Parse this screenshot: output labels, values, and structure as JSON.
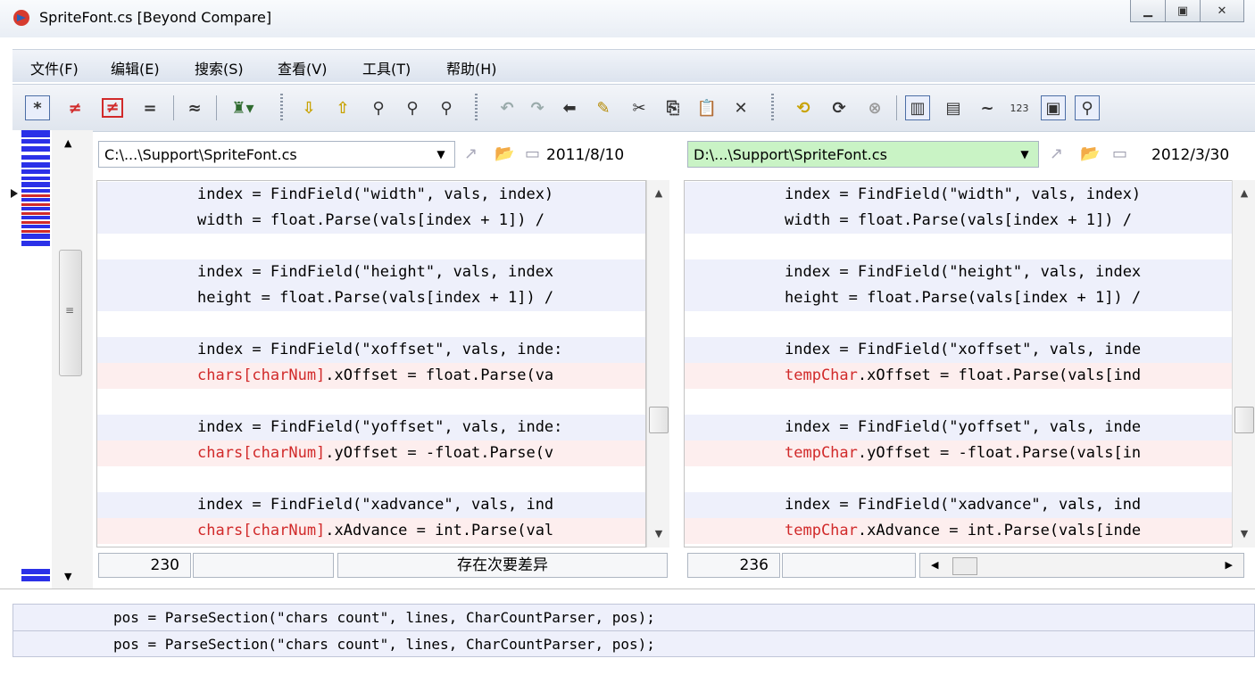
{
  "window": {
    "title": "SpriteFont.cs  [Beyond Compare]"
  },
  "menu": [
    "文件(F)",
    "编辑(E)",
    "搜索(S)",
    "查看(V)",
    "工具(T)",
    "帮助(H)"
  ],
  "colors": {
    "diff_text": "#d12a2a",
    "changed_line_bg": "#fdeeee",
    "line_bg": "#eef0fb",
    "right_path_bg": "#c9f3c5"
  },
  "left": {
    "path": "C:\\...\\Support\\SpriteFont.cs",
    "date": "2011/8/10",
    "line_number": "230",
    "status": "存在次要差异",
    "lines": [
      {
        "text": "index = FindField(\"width\", vals, index)",
        "kind": "blue"
      },
      {
        "text": "width = float.Parse(vals[index + 1]) /",
        "kind": "blue"
      },
      {
        "text": "",
        "kind": "blank"
      },
      {
        "text": "index = FindField(\"height\", vals, index",
        "kind": "blue"
      },
      {
        "text": "height = float.Parse(vals[index + 1]) /",
        "kind": "blue"
      },
      {
        "text": "",
        "kind": "blank"
      },
      {
        "text": "index = FindField(\"xoffset\", vals, inde:",
        "kind": "blue"
      },
      {
        "diff": "chars[charNum]",
        "rest": ".xOffset = float.Parse(va",
        "kind": "pink"
      },
      {
        "text": "",
        "kind": "blank"
      },
      {
        "text": "index = FindField(\"yoffset\", vals, inde:",
        "kind": "blue"
      },
      {
        "diff": "chars[charNum]",
        "rest": ".yOffset = -float.Parse(v",
        "kind": "pink"
      },
      {
        "text": "",
        "kind": "blank"
      },
      {
        "text": "index = FindField(\"xadvance\", vals, ind",
        "kind": "blue"
      },
      {
        "diff": "chars[charNum]",
        "rest": ".xAdvance = int.Parse(val",
        "kind": "pink"
      }
    ]
  },
  "right": {
    "path": "D:\\...\\Support\\SpriteFont.cs",
    "date": "2012/3/30",
    "line_number": "236",
    "lines": [
      {
        "text": "index = FindField(\"width\", vals, index)",
        "kind": "blue"
      },
      {
        "text": "width = float.Parse(vals[index + 1]) /",
        "kind": "blue"
      },
      {
        "text": "",
        "kind": "blank"
      },
      {
        "text": "index = FindField(\"height\", vals, index",
        "kind": "blue"
      },
      {
        "text": "height = float.Parse(vals[index + 1]) /",
        "kind": "blue"
      },
      {
        "text": "",
        "kind": "blank"
      },
      {
        "text": "index = FindField(\"xoffset\", vals, inde",
        "kind": "blue"
      },
      {
        "diff": "tempChar",
        "rest": ".xOffset = float.Parse(vals[ind",
        "kind": "pink"
      },
      {
        "text": "",
        "kind": "blank"
      },
      {
        "text": "index = FindField(\"yoffset\", vals, inde",
        "kind": "blue"
      },
      {
        "diff": "tempChar",
        "rest": ".yOffset = -float.Parse(vals[in",
        "kind": "pink"
      },
      {
        "text": "",
        "kind": "blank"
      },
      {
        "text": "index = FindField(\"xadvance\", vals, ind",
        "kind": "blue"
      },
      {
        "diff": "tempChar",
        "rest": ".xAdvance = int.Parse(vals[inde",
        "kind": "pink"
      }
    ]
  },
  "bottom": {
    "line1": "pos = ParseSection(\"chars count\", lines, CharCountParser, pos);",
    "line2": "pos = ParseSection(\"chars count\", lines, CharCountParser, pos);"
  }
}
